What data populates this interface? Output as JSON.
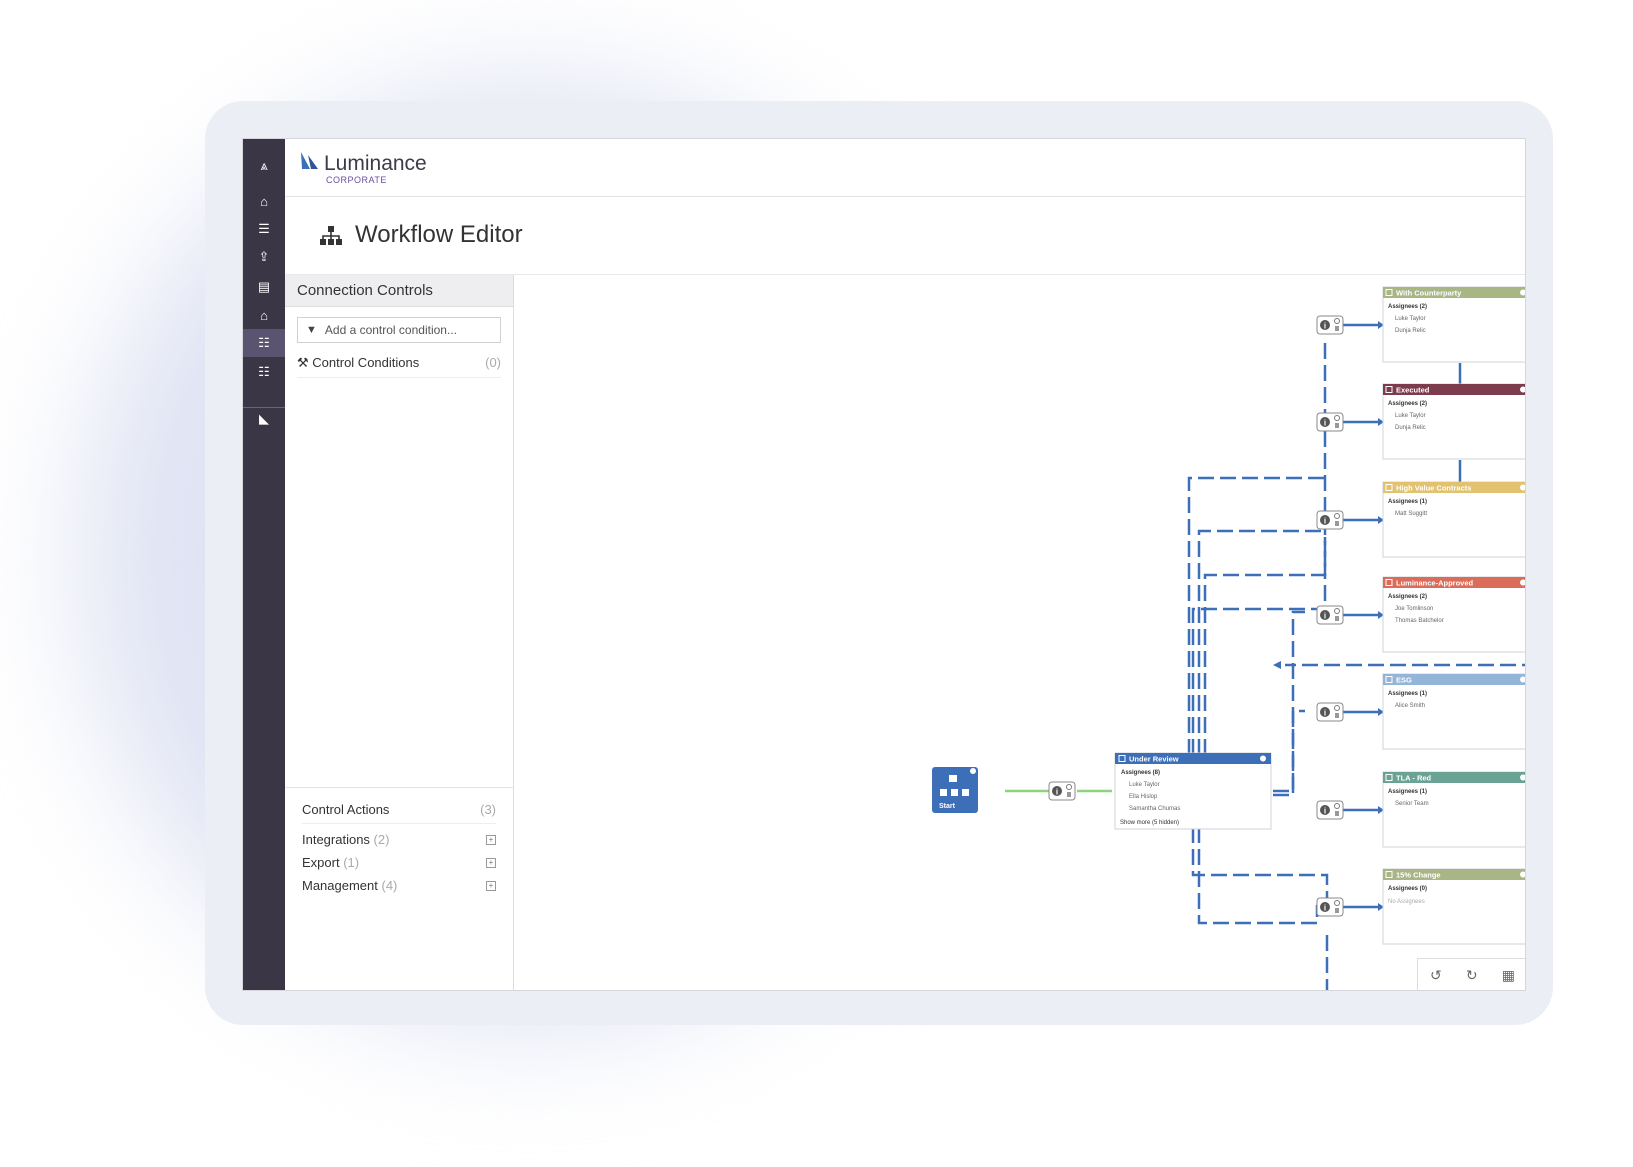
{
  "app": {
    "brand_name": "Luminance",
    "brand_sub": "CORPORATE",
    "page_title": "Workflow Editor"
  },
  "rail": {
    "items": [
      {
        "icon": "logo-icon"
      },
      {
        "icon": "home-icon"
      },
      {
        "icon": "list-icon"
      },
      {
        "icon": "upload-icon"
      },
      {
        "icon": "library-icon"
      },
      {
        "icon": "bank-icon"
      },
      {
        "icon": "workflow-icon",
        "active": true
      },
      {
        "icon": "document-icon"
      },
      {
        "icon": "sail-icon"
      }
    ]
  },
  "panel": {
    "header": "Connection Controls",
    "search_placeholder": "Add a control condition...",
    "conditions_label": "Control Conditions",
    "conditions_count": "(0)",
    "actions_label": "Control Actions",
    "actions_count": "(3)",
    "action_groups": [
      {
        "label": "Integrations",
        "count": "(2)"
      },
      {
        "label": "Export",
        "count": "(1)"
      },
      {
        "label": "Management",
        "count": "(4)"
      }
    ]
  },
  "workflow": {
    "start_label": "Start",
    "under_review": {
      "title": "Under Review",
      "assignees": "Assignees",
      "count": "(8)",
      "people": [
        "Luke Taylor",
        "Ella Hislop",
        "Samantha Chumas"
      ],
      "more": "Show more",
      "hidden": "(5 hidden)",
      "color": "#3d6fb8"
    },
    "stages": [
      {
        "title": "With Counterparty",
        "count": "(2)",
        "people": [
          "Luke Taylor",
          "Dunja Relic"
        ],
        "color": "#a8b585"
      },
      {
        "title": "Executed",
        "count": "(2)",
        "people": [
          "Luke Taylor",
          "Dunja Relic"
        ],
        "color": "#7d3b4e"
      },
      {
        "title": "High Value Contracts",
        "count": "(1)",
        "people": [
          "Matt Suggitt"
        ],
        "color": "#e2c26f"
      },
      {
        "title": "Luminance-Approved",
        "count": "(2)",
        "people": [
          "Joe Tomlinson",
          "Thomas Batchelor"
        ],
        "color": "#db6c5a"
      },
      {
        "title": "ESG",
        "count": "(1)",
        "people": [
          "Alice Smith"
        ],
        "color": "#93b6d8"
      },
      {
        "title": "TLA - Red",
        "count": "(1)",
        "people": [
          "Senior Team"
        ],
        "color": "#6aa394"
      },
      {
        "title": "15% Change",
        "count": "(0)",
        "people": [],
        "empty": "No Assignees",
        "color": "#a9b587"
      }
    ],
    "assignees_word": "Assignees",
    "line_color": "#3d6fb8",
    "start_line_color": "#8fd37e"
  },
  "controls": [
    "undo-icon",
    "redo-icon",
    "layout-icon"
  ]
}
